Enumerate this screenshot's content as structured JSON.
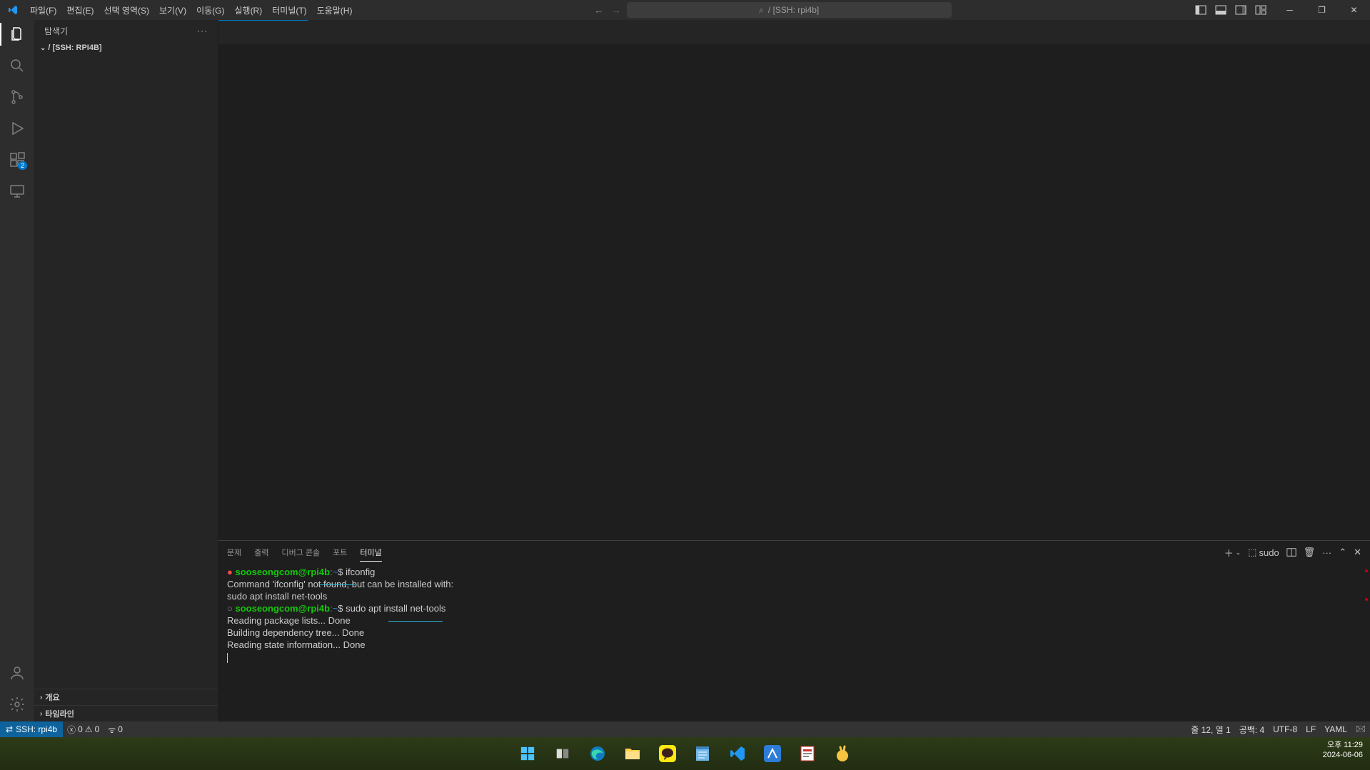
{
  "menu": {
    "file": "파일(F)",
    "edit": "편집(E)",
    "selection": "선택 영역(S)",
    "view": "보기(V)",
    "go": "이동(G)",
    "run": "실행(R)",
    "terminal": "터미널(T)",
    "help": "도움말(H)"
  },
  "search_text": "/ [SSH: rpi4b]",
  "sidebar": {
    "title": "탐색기",
    "folder": "/ [SSH: RPI4B]",
    "outline": "개요",
    "timeline": "타임라인"
  },
  "activity_badge": "2",
  "panel_tabs": {
    "problems": "문제",
    "output": "출력",
    "debug": "디버그 콘솔",
    "ports": "포트",
    "terminal": "터미널"
  },
  "panel_actions": {
    "shell": "sudo"
  },
  "terminal": {
    "l1_prompt_user": "sooseongcom@rpi4b",
    "l1_prompt_path": ":~",
    "l1_prompt_sym": "$ ",
    "l1_cmd": "ifconfig",
    "l2": "Command 'ifconfig' not found, but can be installed with:",
    "l3": "sudo apt install net-tools",
    "l4_prompt_user": "sooseongcom@rpi4b",
    "l4_prompt_path": ":~",
    "l4_prompt_sym": "$ ",
    "l4_cmd": "sudo apt install net-tools",
    "l5": "Reading package lists... Done",
    "l6": "Building dependency tree... Done",
    "l7": "Reading state information... Done"
  },
  "status": {
    "remote": "SSH: rpi4b",
    "errors": "0",
    "warnings": "0",
    "ports": "0",
    "ln_col": "줄 12, 열 1",
    "spaces": "공백: 4",
    "encoding": "UTF-8",
    "eol": "LF",
    "lang": "YAML"
  },
  "clock": {
    "time": "오후 11:29",
    "date": "2024-06-06"
  }
}
